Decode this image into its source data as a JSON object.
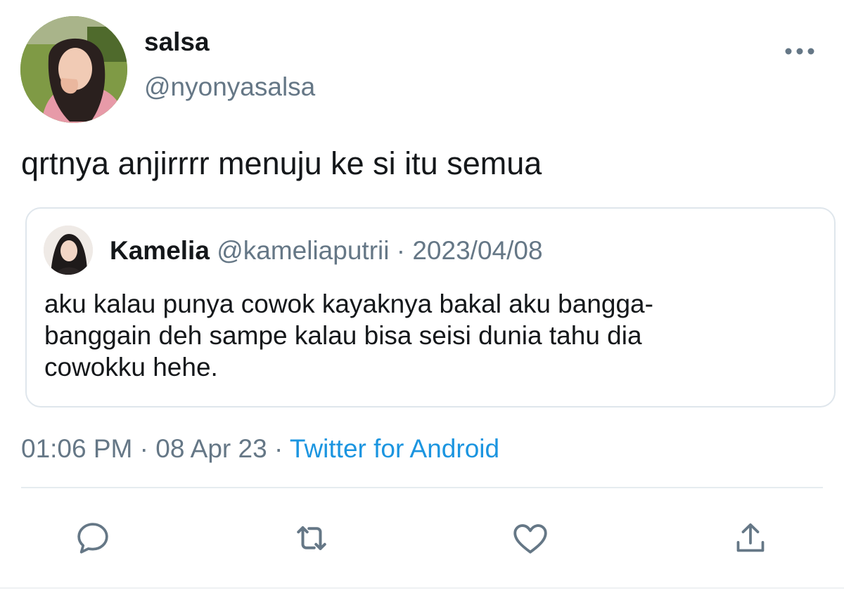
{
  "author": {
    "display_name": "salsa",
    "handle": "@nyonyasalsa"
  },
  "tweet": {
    "text": "qrtnya anjirrrr menuju ke si itu semua"
  },
  "quoted": {
    "name": "Kamelia",
    "handle": "@kameliaputrii",
    "separator": " · ",
    "date": "2023/04/08",
    "text": "aku kalau punya cowok kayaknya bakal aku bangga-banggain deh sampe kalau bisa seisi dunia tahu dia cowokku hehe."
  },
  "meta": {
    "time": "01:06 PM",
    "sep1": " · ",
    "date": "08 Apr 23",
    "sep2": " · ",
    "source": "Twitter for Android"
  },
  "icons": {
    "more": "more-horizontal-icon",
    "reply": "reply-icon",
    "retweet": "retweet-icon",
    "like": "heart-icon",
    "share": "share-icon"
  },
  "colors": {
    "secondary_text": "#657786",
    "link": "#1b95e0",
    "icon": "#657786"
  }
}
